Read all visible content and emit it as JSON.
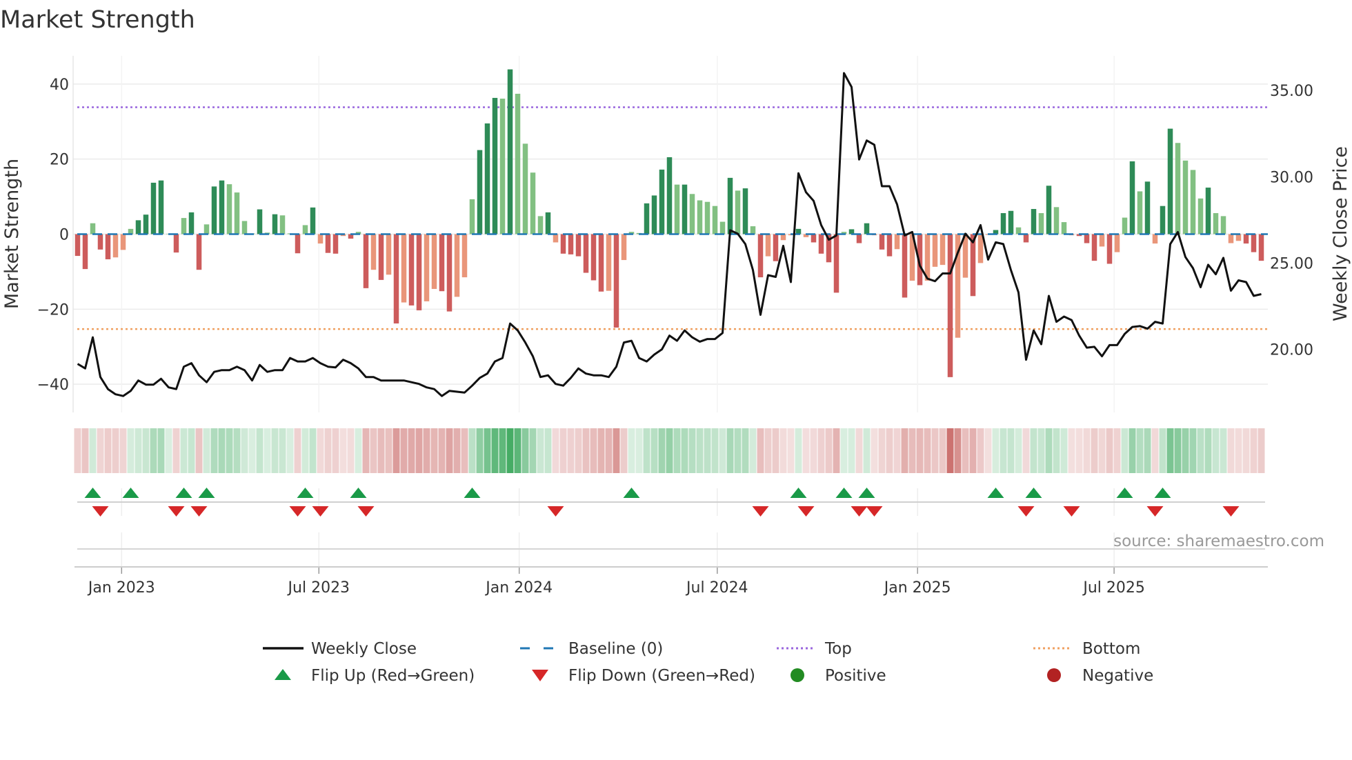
{
  "chart_data": {
    "type": "bar",
    "title": "Market Strength",
    "ylabel": "Market Strength",
    "y2label": "Weekly Close Price",
    "ylim": [
      -47.5,
      47.5
    ],
    "y2lim": [
      16.35,
      37
    ],
    "yticks": [
      40,
      20,
      0,
      -20,
      -40
    ],
    "yticks_labels": [
      "40",
      "20",
      "0",
      "−20",
      "−40"
    ],
    "y2ticks": [
      35,
      30,
      25,
      20
    ],
    "y2ticks_labels": [
      "35.00",
      "30.00",
      "25.00",
      "20.00"
    ],
    "xticks": [
      {
        "week": 6.8,
        "label": "Jan 2023"
      },
      {
        "week": 32.8,
        "label": "Jul 2023"
      },
      {
        "week": 59.2,
        "label": "Jan 2024"
      },
      {
        "week": 85.3,
        "label": "Jul 2024"
      },
      {
        "week": 111.7,
        "label": "Jan 2025"
      },
      {
        "week": 137.6,
        "label": "Jul 2025"
      }
    ],
    "grid": true,
    "top_level": 33.8,
    "bottom_level": -25.3,
    "baseline": 0,
    "strength": [
      -5.8,
      -9.3,
      2.9,
      -4.1,
      -6.7,
      -6.2,
      -4.2,
      1.4,
      3.7,
      5.2,
      13.7,
      14.3,
      0.1,
      -4.9,
      4.3,
      5.8,
      -9.5,
      2.6,
      12.7,
      14.3,
      13.3,
      11.1,
      3.5,
      0.2,
      6.6,
      0.4,
      5.3,
      5.0,
      0.2,
      -5.1,
      2.4,
      7.1,
      -2.5,
      -5.0,
      -5.2,
      -0.5,
      -1.2,
      0.6,
      -14.4,
      -9.5,
      -12.2,
      -10.8,
      -23.8,
      -18.2,
      -19,
      -20.3,
      -17.9,
      -14.6,
      -15.2,
      -20.6,
      -16.7,
      -11.5,
      9.3,
      22.4,
      29.5,
      36.3,
      36.1,
      43.9,
      37.4,
      24.1,
      16.4,
      4.8,
      5.8,
      -2.2,
      -5.2,
      -5.4,
      -5.9,
      -10.3,
      -12.3,
      -15.3,
      -15.1,
      -24.9,
      -6.9,
      0.6,
      0.3,
      8.2,
      10.3,
      17.2,
      20.5,
      13.2,
      13.2,
      10.7,
      9,
      8.6,
      7.5,
      3.3,
      15,
      11.6,
      12.2,
      2.1,
      -11.5,
      -5.9,
      -7.2,
      -1.6,
      -0.3,
      1.4,
      -0.8,
      -2.2,
      -5.2,
      -7.5,
      -15.6,
      0.6,
      1.3,
      -2.4,
      2.9,
      -0.3,
      -4.1,
      -5.9,
      -4.0,
      -16.9,
      -12.4,
      -13.6,
      -12.4,
      -8.7,
      -8.2,
      -38.1,
      -27.6,
      -11.6,
      -16.5,
      -7.7,
      -0.2,
      1.1,
      5.6,
      6.2,
      1.8,
      -2.2,
      6.7,
      5.6,
      12.9,
      7.2,
      3.2,
      -0.3,
      -0.5,
      -2.4,
      -7.1,
      -3.3,
      -7.9,
      -4.8,
      4.4,
      19.4,
      11.4,
      14,
      -2.5,
      7.5,
      28.1,
      24.3,
      19.6,
      17.1,
      9.5,
      12.4,
      5.6,
      4.8,
      -2.4,
      -1.8,
      -2.5,
      -4.8,
      -7.1
    ],
    "weekly_close": [
      19.16,
      18.9,
      20.7,
      18.4,
      17.7,
      17.4,
      17.3,
      17.6,
      18.2,
      17.96,
      17.96,
      18.3,
      17.8,
      17.7,
      19.0,
      19.2,
      18.5,
      18.1,
      18.7,
      18.8,
      18.8,
      19.0,
      18.8,
      18.2,
      19.1,
      18.7,
      18.8,
      18.8,
      19.5,
      19.3,
      19.3,
      19.5,
      19.2,
      19.0,
      18.96,
      19.4,
      19.2,
      18.9,
      18.4,
      18.4,
      18.2,
      18.2,
      18.2,
      18.2,
      18.1,
      18.0,
      17.8,
      17.7,
      17.3,
      17.6,
      17.55,
      17.5,
      17.9,
      18.35,
      18.6,
      19.3,
      19.5,
      21.5,
      21.1,
      20.4,
      19.6,
      18.4,
      18.5,
      18.0,
      17.9,
      18.35,
      18.9,
      18.6,
      18.5,
      18.5,
      18.4,
      19.0,
      20.4,
      20.5,
      19.5,
      19.3,
      19.7,
      20.0,
      20.8,
      20.5,
      21.1,
      20.7,
      20.45,
      20.6,
      20.6,
      20.95,
      26.9,
      26.7,
      26.1,
      24.6,
      22.0,
      24.3,
      24.2,
      26.0,
      23.9,
      30.2,
      29.1,
      28.6,
      27.2,
      26.35,
      26.6,
      36.0,
      35.2,
      31.0,
      32.1,
      31.85,
      29.45,
      29.45,
      28.4,
      26.6,
      26.8,
      24.85,
      24.1,
      23.95,
      24.4,
      24.4,
      25.6,
      26.7,
      26.2,
      27.2,
      25.2,
      26.2,
      26.1,
      24.6,
      23.3,
      19.4,
      21.1,
      20.3,
      23.1,
      21.6,
      21.9,
      21.7,
      20.8,
      20.1,
      20.15,
      19.6,
      20.25,
      20.25,
      20.9,
      21.3,
      21.35,
      21.2,
      21.6,
      21.5,
      26.1,
      26.8,
      25.35,
      24.7,
      23.6,
      24.9,
      24.35,
      25.3,
      23.4,
      24.0,
      23.9,
      23.1,
      23.2
    ],
    "flip_up_weeks": [
      3,
      8,
      15,
      18,
      31,
      38,
      53,
      74,
      96,
      102,
      105,
      122,
      127,
      139,
      144
    ],
    "flip_down_weeks": [
      4,
      14,
      17,
      30,
      33,
      39,
      64,
      91,
      97,
      104,
      106,
      126,
      132,
      143,
      153
    ],
    "legend": {
      "placement": "bottom",
      "items": [
        {
          "key": "close",
          "label": "Weekly Close"
        },
        {
          "key": "baseline",
          "label": "Baseline (0)"
        },
        {
          "key": "top",
          "label": "Top"
        },
        {
          "key": "bottom",
          "label": "Bottom"
        },
        {
          "key": "flip_up",
          "label": "Flip Up (Red→Green)"
        },
        {
          "key": "flip_down",
          "label": "Flip Down (Green→Red)"
        },
        {
          "key": "positive",
          "label": "Positive"
        },
        {
          "key": "negative",
          "label": "Negative"
        }
      ]
    },
    "annotation": "source: sharemaestro.com"
  },
  "colors": {
    "pos_strong": "#2e8b57",
    "pos_weak": "#82c082",
    "neg_strong": "#cd5c5c",
    "neg_weak": "#e9967a",
    "heat_pos": "#31a354",
    "heat_neg": "#c0504d",
    "close": "#111111",
    "baseline": "#1f77b4",
    "top": "#9966dd",
    "bottom": "#f0a060",
    "flip_up": "#1a9a48",
    "flip_down": "#d62728",
    "positive": "#228b22",
    "negative": "#b22222",
    "grid": "#ebebeb"
  }
}
